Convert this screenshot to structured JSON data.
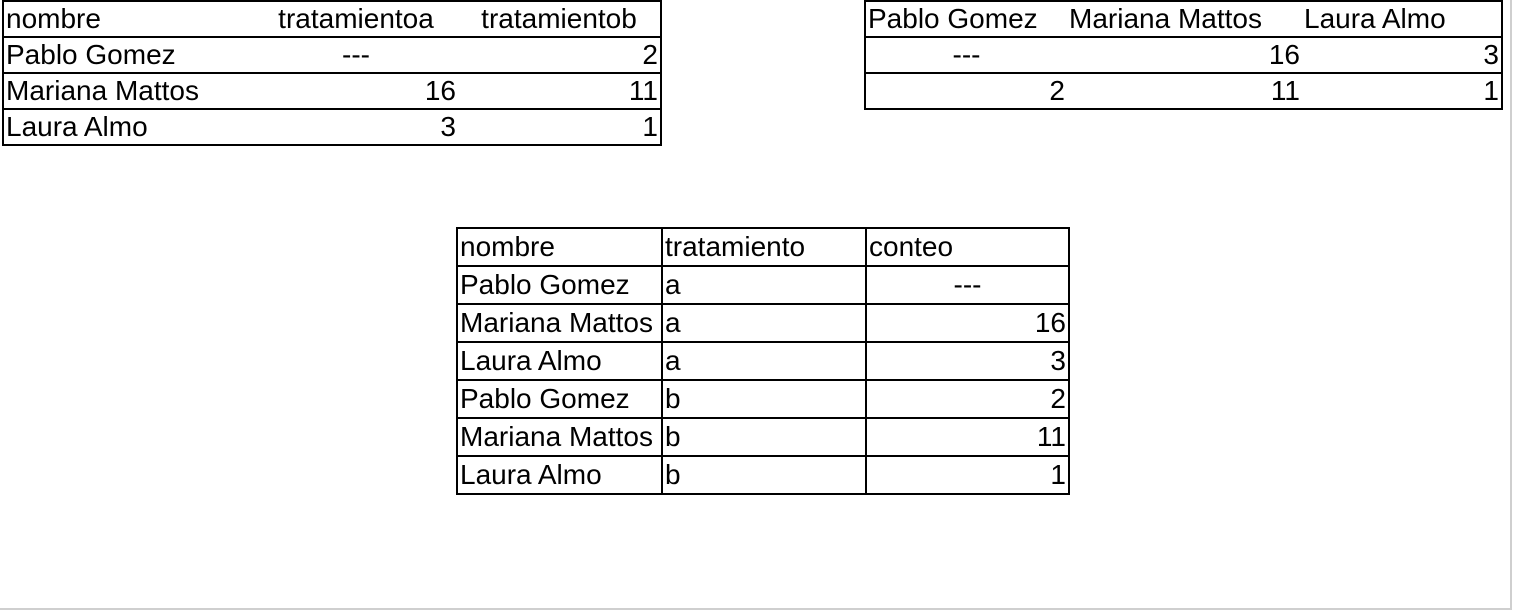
{
  "wide_table": {
    "headers": [
      "nombre",
      "tratamientoa",
      "tratamientob"
    ],
    "rows": [
      [
        "Pablo Gomez",
        "---",
        "2"
      ],
      [
        "Mariana Mattos",
        "16",
        "11"
      ],
      [
        "Laura Almo",
        "3",
        "1"
      ]
    ]
  },
  "transposed_table": {
    "headers": [
      "Pablo Gomez",
      "Mariana Mattos",
      "Laura Almo"
    ],
    "rows": [
      [
        "---",
        "16",
        "3"
      ],
      [
        "2",
        "11",
        "1"
      ]
    ]
  },
  "long_table": {
    "headers": [
      "nombre",
      "tratamiento",
      "conteo"
    ],
    "rows": [
      [
        "Pablo Gomez",
        "a",
        "---"
      ],
      [
        "Mariana Mattos",
        "a",
        "16"
      ],
      [
        "Laura Almo",
        "a",
        "3"
      ],
      [
        "Pablo Gomez",
        "b",
        "2"
      ],
      [
        "Mariana Mattos",
        "b",
        "11"
      ],
      [
        "Laura Almo",
        "b",
        "1"
      ]
    ]
  }
}
